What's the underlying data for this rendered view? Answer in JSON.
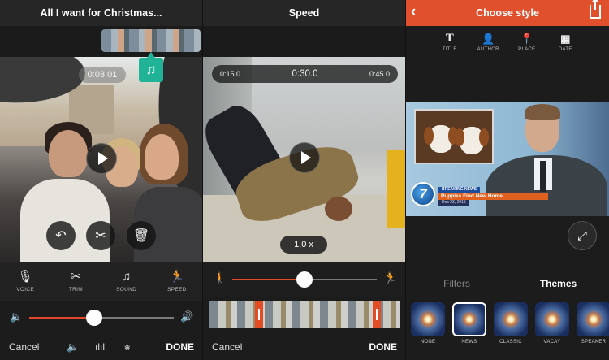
{
  "panel_edit": {
    "title": "All I want for Christmas...",
    "current_time": "0:03.01",
    "tools": [
      {
        "label": "VOICE",
        "icon": "microphone-icon"
      },
      {
        "label": "TRIM",
        "icon": "scissors-icon"
      },
      {
        "label": "SOUND",
        "icon": "music-note-icon"
      },
      {
        "label": "SPEED",
        "icon": "running-icon"
      }
    ],
    "volume_level": 0.45,
    "cancel_label": "Cancel",
    "done_label": "DONE"
  },
  "panel_speed": {
    "title": "Speed",
    "time_start": "0:15.0",
    "time_mid": "0:30.0",
    "time_end": "0:45.0",
    "speed_label": "1.0 x",
    "speed_level": 0.5,
    "cancel_label": "Cancel",
    "done_label": "DONE"
  },
  "panel_style": {
    "title": "Choose style",
    "style_tabs": [
      {
        "label": "TITLE",
        "icon": "title-icon"
      },
      {
        "label": "AUTHOR",
        "icon": "person-icon"
      },
      {
        "label": "PLACE",
        "icon": "map-pin-icon"
      },
      {
        "label": "DATE",
        "icon": "calendar-icon"
      }
    ],
    "news_overlay": {
      "channel": "7",
      "breaking": "BREAKING NEWS",
      "headline": "Puppies Find New Home",
      "date": "Dec 23, 2015"
    },
    "segments": {
      "filters": "Filters",
      "themes": "Themes",
      "active": "themes"
    },
    "themes": [
      {
        "label": "NONE"
      },
      {
        "label": "NEWS",
        "selected": true
      },
      {
        "label": "CLASSIC"
      },
      {
        "label": "VACAY"
      },
      {
        "label": "SPEAKER"
      }
    ]
  },
  "colors": {
    "accent": "#e04a2b",
    "teal": "#21b398",
    "header_red": "#e0502d"
  }
}
